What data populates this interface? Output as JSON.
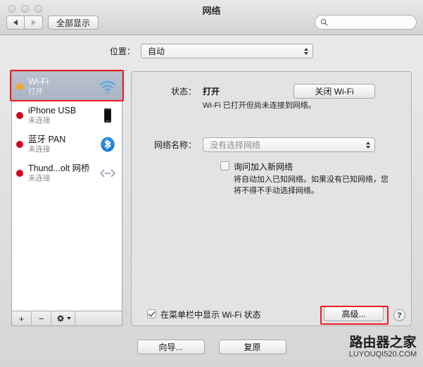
{
  "window": {
    "title": "网络",
    "traffic_lights": [
      "close",
      "minimize",
      "zoom"
    ]
  },
  "toolbar": {
    "back_icon": "back-arrow-icon",
    "forward_icon": "forward-arrow-icon",
    "show_all_label": "全部显示",
    "search_placeholder": "",
    "search_value": "",
    "search_icon": "search-icon"
  },
  "location": {
    "label": "位置：",
    "selected": "自动",
    "options": [
      "自动"
    ]
  },
  "sidebar": {
    "interfaces": [
      {
        "name": "Wi-Fi",
        "status": "打开",
        "dot_color": "#f5a623",
        "icon": "wifi-icon",
        "selected": true
      },
      {
        "name": "iPhone USB",
        "status": "未连接",
        "dot_color": "#d0021b",
        "icon": "iphone-icon",
        "selected": false
      },
      {
        "name": "蓝牙 PAN",
        "status": "未连接",
        "dot_color": "#d0021b",
        "icon": "bluetooth-icon",
        "selected": false
      },
      {
        "name": "Thund...olt 网桥",
        "status": "未连接",
        "dot_color": "#d0021b",
        "icon": "thunderbolt-bridge-icon",
        "selected": false
      }
    ],
    "toolbar": {
      "add_label": "+",
      "remove_label": "−",
      "gear_icon": "gear-icon"
    }
  },
  "main": {
    "status_label": "状态：",
    "status_value": "打开",
    "turn_off_button": "关闭 Wi-Fi",
    "status_description": "Wi-Fi 已打开但尚未连接到网络。",
    "network_name_label": "网络名称：",
    "network_name_value": "没有选择网络",
    "ask_join_checked": false,
    "ask_join_label": "询问加入新网络",
    "ask_join_description": "将自动加入已知网络。如果没有已知网络，您将不得不手动选择网络。",
    "menubar_checked": true,
    "menubar_label": "在菜单栏中显示 Wi-Fi 状态",
    "advanced_button": "高级...",
    "help_button": "?"
  },
  "footer": {
    "assist_button": "向导...",
    "revert_button": "复原"
  },
  "watermark": {
    "chinese": "路由器之家",
    "english": "LUYOUQI520.COM"
  },
  "annotations": {
    "highlight_color": "#ee1c24",
    "boxes": [
      "wifi-sidebar-row",
      "advanced-button"
    ]
  }
}
